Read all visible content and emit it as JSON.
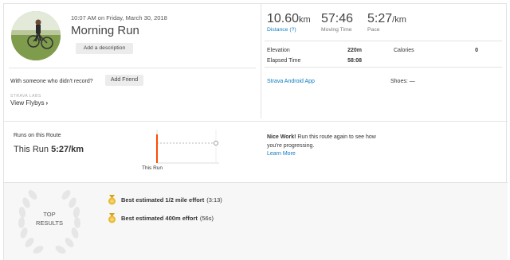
{
  "activity": {
    "timestamp": "10:07 AM on Friday, March 30, 2018",
    "title": "Morning Run",
    "add_description_label": "Add a description",
    "friend_prompt": "With someone who didn't record?",
    "add_friend_label": "Add Friend",
    "labs_label": "STRAVA LABS",
    "flyby_label": "View Flybys",
    "flyby_chevron": "›"
  },
  "stats": {
    "distance": {
      "value": "10.60",
      "unit": "km",
      "label": "Distance (?)"
    },
    "moving_time": {
      "value": "57:46",
      "label": "Moving Time"
    },
    "pace": {
      "value": "5:27",
      "unit": "/km",
      "label": "Pace"
    },
    "elevation": {
      "label": "Elevation",
      "value": "220m"
    },
    "calories": {
      "label": "Calories",
      "value": "0"
    },
    "elapsed_time": {
      "label": "Elapsed Time",
      "value": "58:08"
    },
    "device": "Strava Android App",
    "shoes": "Shoes: —"
  },
  "route": {
    "title": "Runs on this Route",
    "this_run_label": "This Run",
    "this_run_pace": "5:27/km",
    "chart_caption": "This Run",
    "nice_work_bold": "Nice Work!",
    "nice_work_text": "Run this route again to see how you're progressing.",
    "learn_more": "Learn More"
  },
  "results": {
    "badge_label_1": "TOP",
    "badge_label_2": "RESULTS",
    "items": [
      {
        "title": "Best estimated 1/2 mile effort",
        "detail": "(3:13)"
      },
      {
        "title": "Best estimated 400m effort",
        "detail": "(56s)"
      }
    ]
  },
  "colors": {
    "accent": "#fc4c02",
    "link": "#0f7dc2",
    "medal": "#e8b932"
  }
}
